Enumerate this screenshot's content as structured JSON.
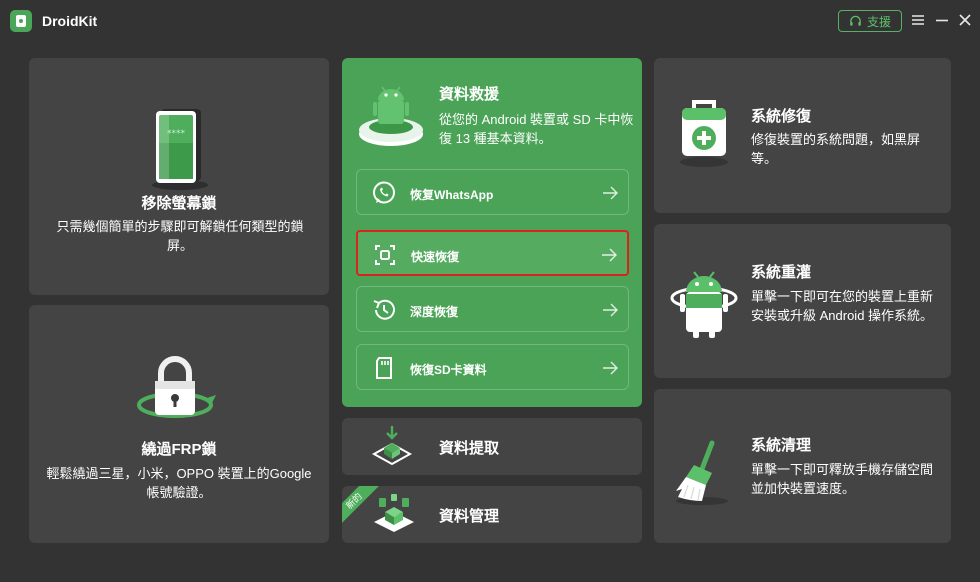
{
  "app": {
    "title": "DroidKit",
    "support_label": "支援"
  },
  "cards": {
    "screen_unlock": {
      "title": "移除螢幕鎖",
      "desc": "只需幾個簡單的步驟即可解鎖任何類型的鎖屏。"
    },
    "frp_bypass": {
      "title": "繞過FRP鎖",
      "desc": "輕鬆繞過三星，小米，OPPO 裝置上的Google帳號驗證。"
    },
    "data_recovery": {
      "title": "資料救援",
      "desc": "從您的 Android 裝置或 SD 卡中恢復 13 種基本資料。",
      "options": [
        {
          "label": "恢复WhatsApp"
        },
        {
          "label": "快速恢復"
        },
        {
          "label": "深度恢復"
        },
        {
          "label": "恢復SD卡資料"
        }
      ]
    },
    "data_extract": {
      "title": "資料提取"
    },
    "data_manager": {
      "title": "資料管理",
      "badge": "新的"
    },
    "system_repair": {
      "title": "系統修復",
      "desc": "修復裝置的系統問題，如黑屏等。"
    },
    "system_reinstall": {
      "title": "系統重灌",
      "desc": "單擊一下即可在您的裝置上重新安裝或升級 Android 操作系統。"
    },
    "system_clean": {
      "title": "系統清理",
      "desc": "單擊一下即可釋放手機存儲空間並加快裝置速度。"
    }
  },
  "colors": {
    "accent": "#4ba357",
    "highlight_border": "#d9231d",
    "background": "#333334",
    "card": "#444445"
  }
}
